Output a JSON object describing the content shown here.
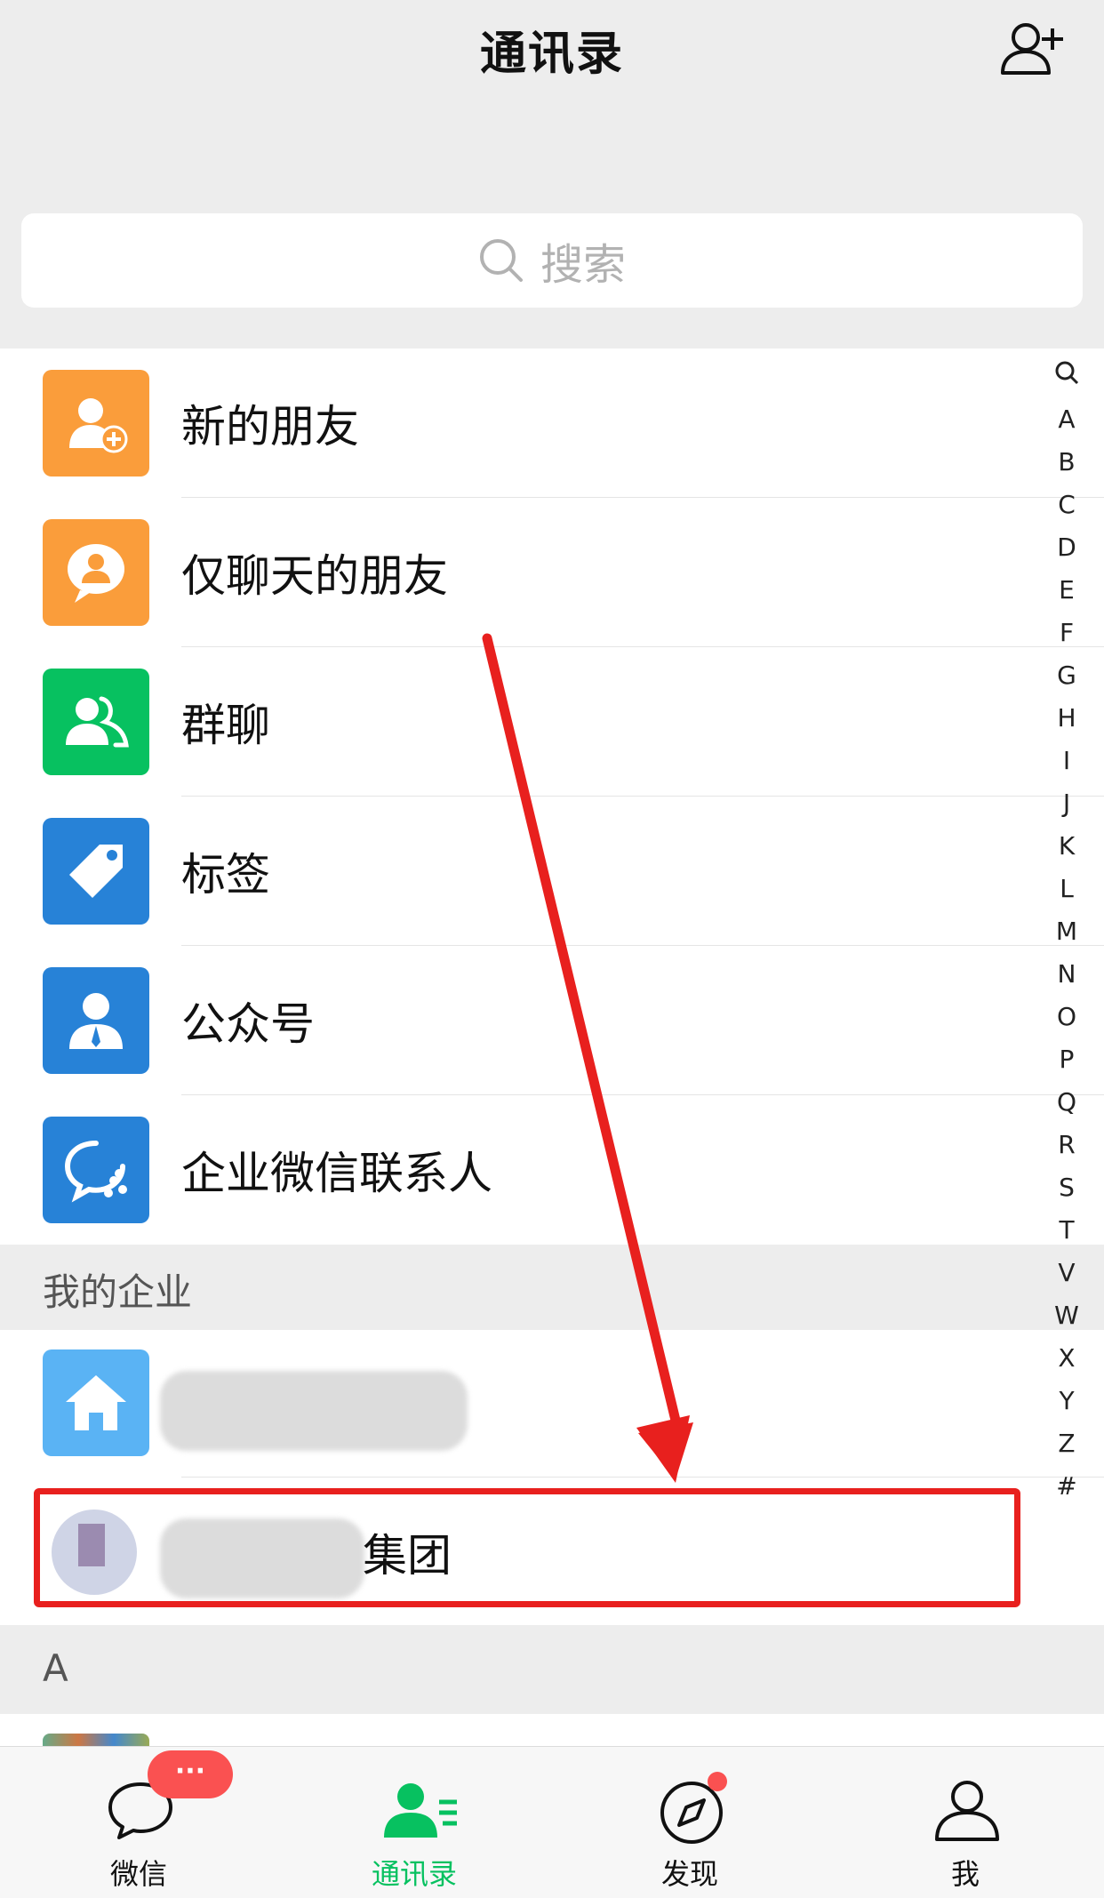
{
  "header": {
    "title": "通讯录"
  },
  "search": {
    "placeholder": "搜索"
  },
  "functions": [
    {
      "label": "新的朋友",
      "icon": "new-friends-icon",
      "color": "#fa9d3b"
    },
    {
      "label": "仅聊天的朋友",
      "icon": "chat-only-friends-icon",
      "color": "#fa9d3b"
    },
    {
      "label": "群聊",
      "icon": "group-chat-icon",
      "color": "#07c160"
    },
    {
      "label": "标签",
      "icon": "tag-icon",
      "color": "#2782d7"
    },
    {
      "label": "公众号",
      "icon": "official-account-icon",
      "color": "#2782d7"
    },
    {
      "label": "企业微信联系人",
      "icon": "wecom-contacts-icon",
      "color": "#2782d7"
    }
  ],
  "enterprise": {
    "header": "我的企业",
    "item2_suffix": "集团"
  },
  "letter_section": {
    "label": "A"
  },
  "index": [
    "Q-icon",
    "A",
    "B",
    "C",
    "D",
    "E",
    "F",
    "G",
    "H",
    "I",
    "J",
    "K",
    "L",
    "M",
    "N",
    "O",
    "P",
    "Q",
    "R",
    "S",
    "T",
    "V",
    "W",
    "X",
    "Y",
    "Z",
    "#"
  ],
  "tabs": [
    {
      "label": "微信",
      "icon": "chat-icon",
      "badge": "···"
    },
    {
      "label": "通讯录",
      "icon": "contacts-icon",
      "active": true
    },
    {
      "label": "发现",
      "icon": "compass-icon",
      "dot": true
    },
    {
      "label": "我",
      "icon": "person-icon"
    }
  ],
  "colors": {
    "active_green": "#07c160",
    "badge_red": "#fa5151",
    "annotation_red": "#e8201e"
  }
}
